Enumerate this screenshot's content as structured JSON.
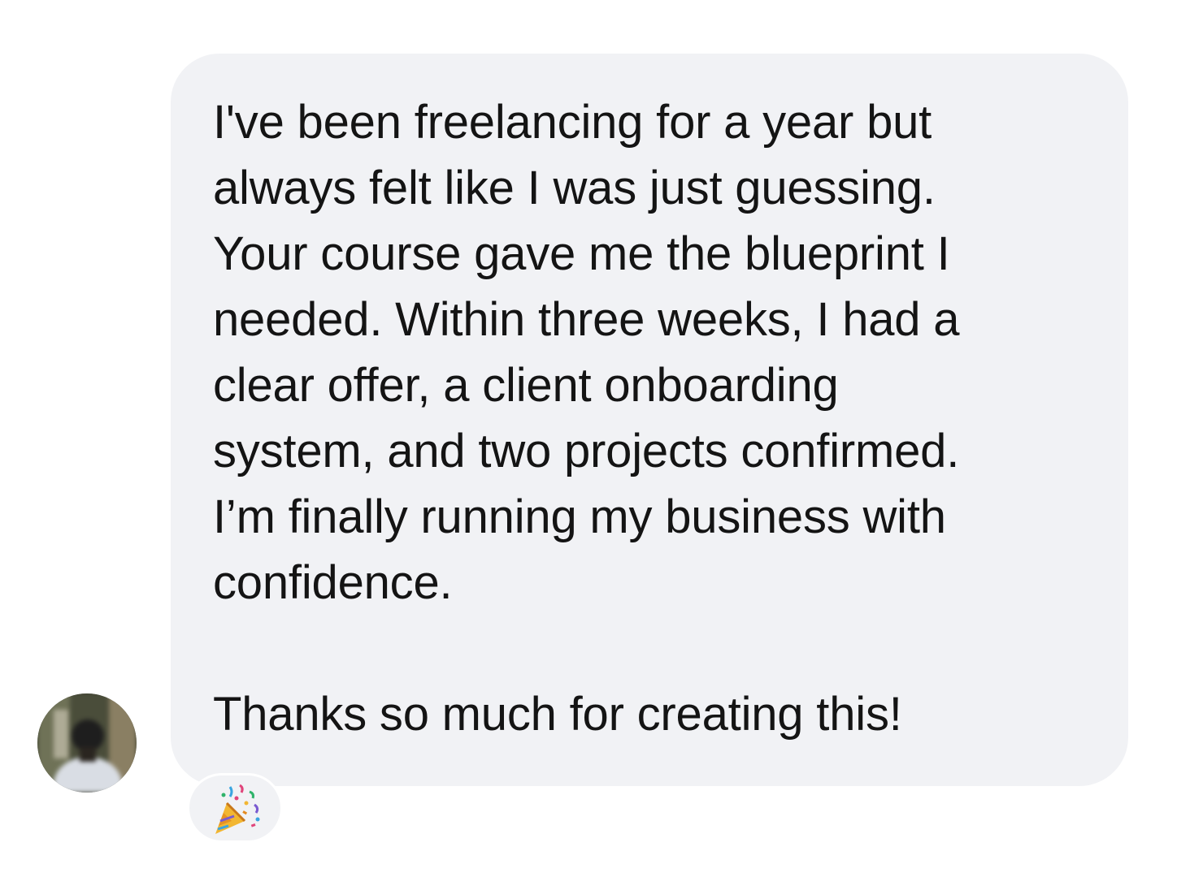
{
  "message": {
    "lines": [
      "I've been freelancing for a year but",
      "always felt like I was just guessing.",
      "Your course gave me the blueprint I",
      "needed. Within three weeks, I had a",
      "clear offer, a client onboarding",
      "system, and two projects confirmed.",
      "I’m finally running my business with",
      "confidence."
    ],
    "closing": "Thanks so much for creating this!"
  },
  "reaction": {
    "emoji": "🎉",
    "icon": "party-popper-icon"
  },
  "avatar": {
    "icon": "user-avatar"
  },
  "colors": {
    "bubble": "#f1f2f5",
    "text": "#141414",
    "background": "#ffffff"
  }
}
